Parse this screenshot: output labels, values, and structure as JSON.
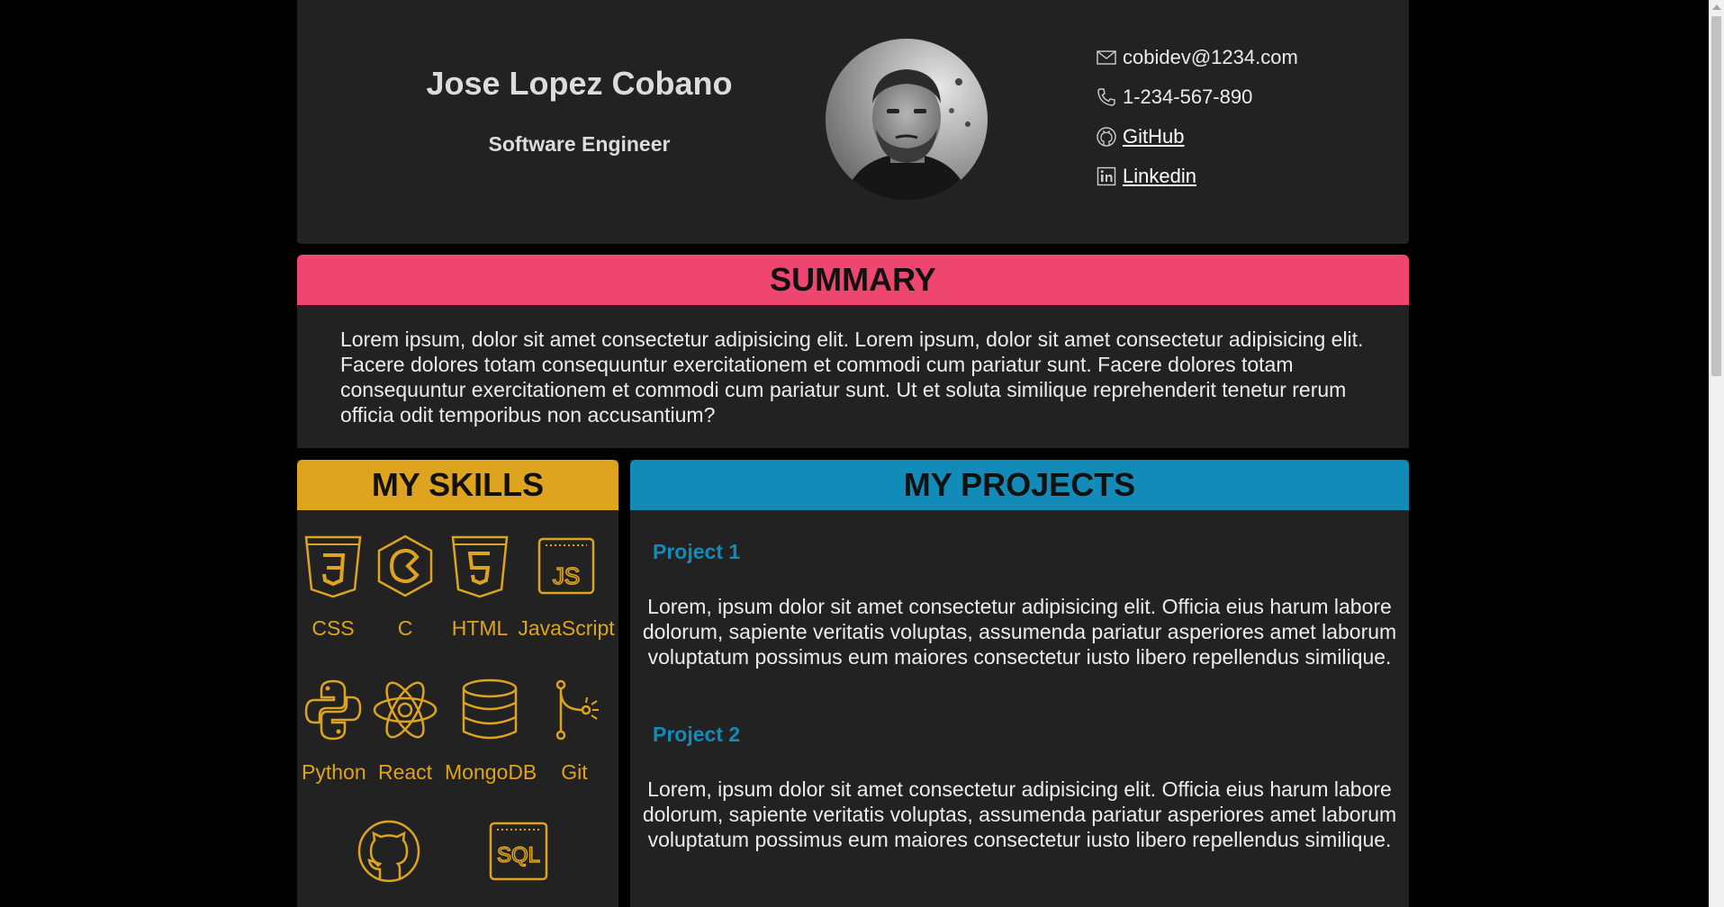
{
  "header": {
    "name": "Jose Lopez Cobano",
    "role": "Software Engineer",
    "contacts": {
      "email": "cobidev@1234.com",
      "phone": "1-234-567-890",
      "github": "GitHub",
      "linkedin": "Linkedin"
    }
  },
  "summary": {
    "title": "SUMMARY",
    "text": "Lorem ipsum, dolor sit amet consectetur adipisicing elit. Lorem ipsum, dolor sit amet consectetur adipisicing elit. Facere dolores totam consequuntur exercitationem et commodi cum pariatur sunt. Facere dolores totam consequuntur exercitationem et commodi cum pariatur sunt. Ut et soluta similique reprehenderit tenetur rerum officia odit temporibus non accusantium?"
  },
  "skills": {
    "title": "MY SKILLS",
    "items": [
      {
        "label": "CSS",
        "icon": "css3-icon"
      },
      {
        "label": "C",
        "icon": "c-icon"
      },
      {
        "label": "HTML",
        "icon": "html5-icon"
      },
      {
        "label": "JavaScript",
        "icon": "javascript-icon"
      },
      {
        "label": "Python",
        "icon": "python-icon"
      },
      {
        "label": "React",
        "icon": "react-icon"
      },
      {
        "label": "MongoDB",
        "icon": "database-icon"
      },
      {
        "label": "Git",
        "icon": "git-icon"
      },
      {
        "label": "",
        "icon": "github-icon"
      },
      {
        "label": "",
        "icon": "sql-icon"
      }
    ]
  },
  "projects": {
    "title": "MY PROJECTS",
    "items": [
      {
        "title": "Project 1",
        "description": "Lorem, ipsum dolor sit amet consectetur adipisicing elit. Officia eius harum labore dolorum, sapiente veritatis voluptas, assumenda pariatur asperiores amet laborum voluptatum possimus eum maiores consectetur iusto libero repellendus similique."
      },
      {
        "title": "Project 2",
        "description": "Lorem, ipsum dolor sit amet consectetur adipisicing elit. Officia eius harum labore dolorum, sapiente veritatis voluptas, assumenda pariatur asperiores amet laborum voluptatum possimus eum maiores consectetur iusto libero repellendus similique."
      }
    ]
  },
  "colors": {
    "summary_accent": "#ef4670",
    "skills_accent": "#dea41f",
    "projects_accent": "#138bb8",
    "panel_bg": "#222222",
    "page_bg": "#000000"
  }
}
